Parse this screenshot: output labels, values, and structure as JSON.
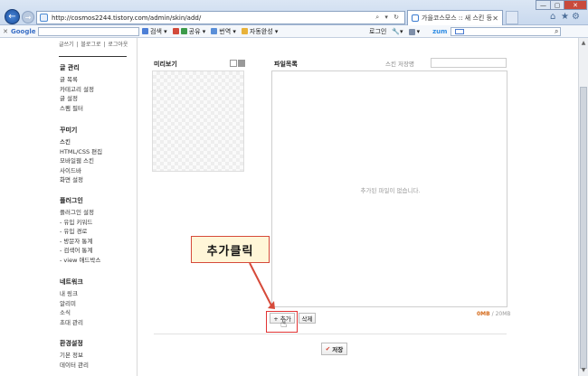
{
  "browser": {
    "url": "http://cosmos2244.tistory.com/admin/skin/add/",
    "address_tools": "⌕ ▾ ↻",
    "tab_title": "가을코스모스 :: 새 스킨 등록",
    "tab_close": "✕",
    "back_icon": "←",
    "forward_icon": "→",
    "window_min": "—",
    "window_max": "▢",
    "window_close": "✕",
    "home_icon": "⌂",
    "favorites_icon": "★",
    "settings_icon": "⚙"
  },
  "toolbar": {
    "close": "✕",
    "google_logo": "Google",
    "search": "검색 ▾",
    "share": "공유 ▾",
    "translate": "번역 ▾",
    "autofill": "자동완성 ▾",
    "login": "로그인",
    "wrench": "🔧▾",
    "extra": "▾",
    "zum_logo": "zum",
    "zum_search_icon": "⌕"
  },
  "sidebar": {
    "top_links": [
      "글쓰기",
      "블로그로",
      "로그아웃"
    ],
    "groups": [
      {
        "heading": "글 관리",
        "items": [
          "글 목록",
          "카테고리 설정",
          "글 설정",
          "스팸 필터"
        ]
      },
      {
        "heading": "꾸미기",
        "items": [
          "스킨",
          "HTML/CSS 편집",
          "모바일웹 스킨",
          "사이드바",
          "화면 설정"
        ]
      },
      {
        "heading": "플러그인",
        "items": [
          "플러그인 설정",
          "- 유입 키워드",
          "- 유입 경로",
          "- 방문자 통계",
          "- 검색어 통계",
          "- view 애드박스"
        ]
      },
      {
        "heading": "네트워크",
        "items": [
          "내 링크",
          "알리미",
          "소식",
          "초대 관리"
        ]
      },
      {
        "heading": "환경설정",
        "items": [
          "기본 정보",
          "데이터 관리"
        ]
      }
    ]
  },
  "preview": {
    "title": "미리보기"
  },
  "files": {
    "title": "파일목록",
    "skin_name_label": "스킨 저장명",
    "skin_name_value": "",
    "empty_message": "추가된 파일이 없습니다.",
    "quota_used": "0MB",
    "quota_total": "/ 20MB"
  },
  "buttons": {
    "add": "+ 추가",
    "delete": "삭제",
    "save": "저장",
    "save_check": "✔"
  },
  "annotation": {
    "callout_text": "추가클릭"
  },
  "colors": {
    "callout_border": "#d64a3a",
    "callout_fill": "#fff6d8",
    "accent_red": "#e23434",
    "quota_orange": "#d46a1a"
  }
}
